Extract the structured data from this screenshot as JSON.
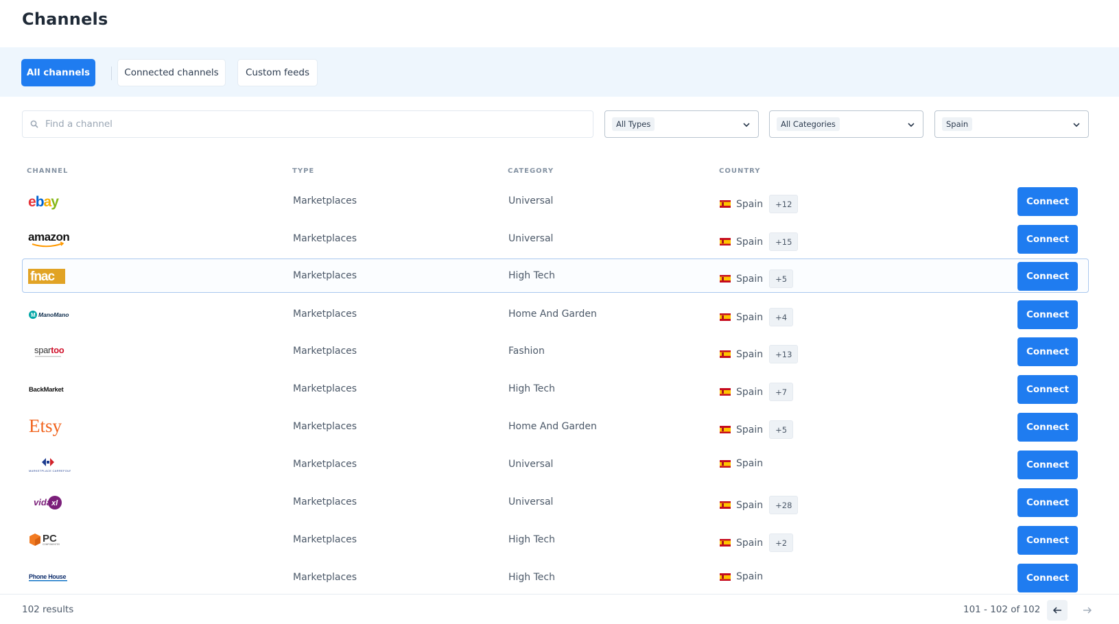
{
  "page": {
    "title": "Channels"
  },
  "tabs": [
    {
      "label": "All channels",
      "active": true
    },
    {
      "label": "Connected channels",
      "active": false
    },
    {
      "label": "Custom feeds",
      "active": false
    }
  ],
  "search": {
    "placeholder": "Find a channel",
    "value": ""
  },
  "filters": {
    "type": "All Types",
    "category": "All Categories",
    "country": "Spain"
  },
  "columns": {
    "channel": "CHANNEL",
    "type": "TYPE",
    "category": "CATEGORY",
    "country": "COUNTRY"
  },
  "rows": [
    {
      "channel": "ebay",
      "type": "Marketplaces",
      "category": "Universal",
      "country": "Spain",
      "more": "+12",
      "action": "Connect"
    },
    {
      "channel": "amazon",
      "type": "Marketplaces",
      "category": "Universal",
      "country": "Spain",
      "more": "+15",
      "action": "Connect"
    },
    {
      "channel": "fnac",
      "type": "Marketplaces",
      "category": "High Tech",
      "country": "Spain",
      "more": "+5",
      "action": "Connect"
    },
    {
      "channel": "ManoMano",
      "type": "Marketplaces",
      "category": "Home And Garden",
      "country": "Spain",
      "more": "+4",
      "action": "Connect"
    },
    {
      "channel": "spartoo",
      "type": "Marketplaces",
      "category": "Fashion",
      "country": "Spain",
      "more": "+13",
      "action": "Connect"
    },
    {
      "channel": "BackMarket",
      "type": "Marketplaces",
      "category": "High Tech",
      "country": "Spain",
      "more": "+7",
      "action": "Connect"
    },
    {
      "channel": "Etsy",
      "type": "Marketplaces",
      "category": "Home And Garden",
      "country": "Spain",
      "more": "+5",
      "action": "Connect"
    },
    {
      "channel": "MARKETPLACE CARREFOUR",
      "type": "Marketplaces",
      "category": "Universal",
      "country": "Spain",
      "more": "",
      "action": "Connect"
    },
    {
      "channel": "vidaXL",
      "type": "Marketplaces",
      "category": "Universal",
      "country": "Spain",
      "more": "+28",
      "action": "Connect"
    },
    {
      "channel": "PC COMPONENTES",
      "type": "Marketplaces",
      "category": "High Tech",
      "country": "Spain",
      "more": "+2",
      "action": "Connect"
    },
    {
      "channel": "Phone House",
      "type": "Marketplaces",
      "category": "High Tech",
      "country": "Spain",
      "more": "",
      "action": "Connect"
    }
  ],
  "footer": {
    "results": "102 results",
    "range": "101 - 102 of 102"
  },
  "colors": {
    "accent": "#1f7cf0",
    "band": "#eef6fd",
    "ebay_red": "#e53238",
    "amazon_orange": "#ff9900",
    "fnac_gold": "#e1a325",
    "etsy_orange": "#f1641e"
  }
}
